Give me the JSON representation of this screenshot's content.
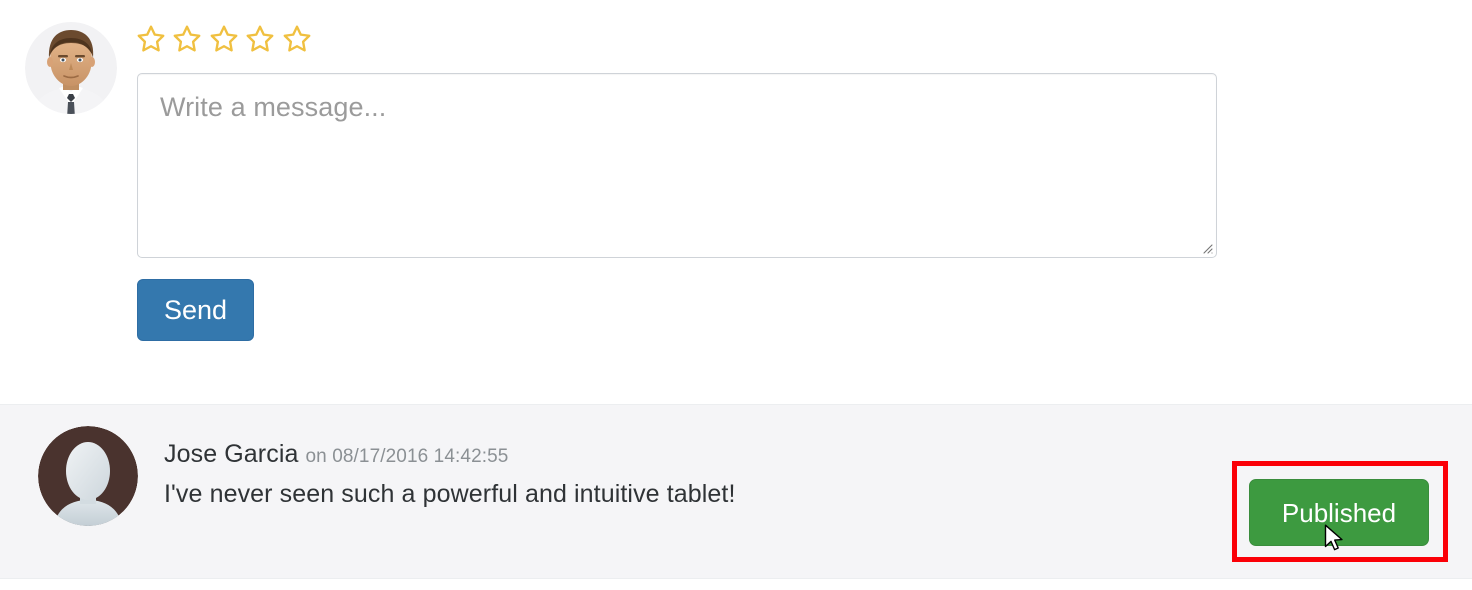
{
  "compose": {
    "avatar": {
      "icon": "user-photo-avatar",
      "alt": "Reviewer portrait"
    },
    "rating": {
      "icon": "star-outline-icon",
      "max": 5,
      "value": 0,
      "color": "#f0c040",
      "stars": [
        "empty",
        "empty",
        "empty",
        "empty",
        "empty"
      ]
    },
    "message": {
      "placeholder": "Write a message...",
      "value": "",
      "resize_handle": "resize-grip-icon"
    },
    "send_label": "Send",
    "send_color": "#3478ae"
  },
  "comment": {
    "avatar": {
      "icon": "default-person-avatar",
      "alt": "Jose Garcia avatar"
    },
    "author": "Jose Garcia",
    "date": "on 08/17/2016 14:42:55",
    "text": "I've never seen such a powerful and intuitive tablet!",
    "status_label": "Published",
    "status_color": "#3d9a40",
    "panel_color": "#f5f5f7"
  },
  "annotation": {
    "highlight_color": "#fb0007",
    "target": "published-button",
    "cursor": "arrow-pointer-icon"
  }
}
